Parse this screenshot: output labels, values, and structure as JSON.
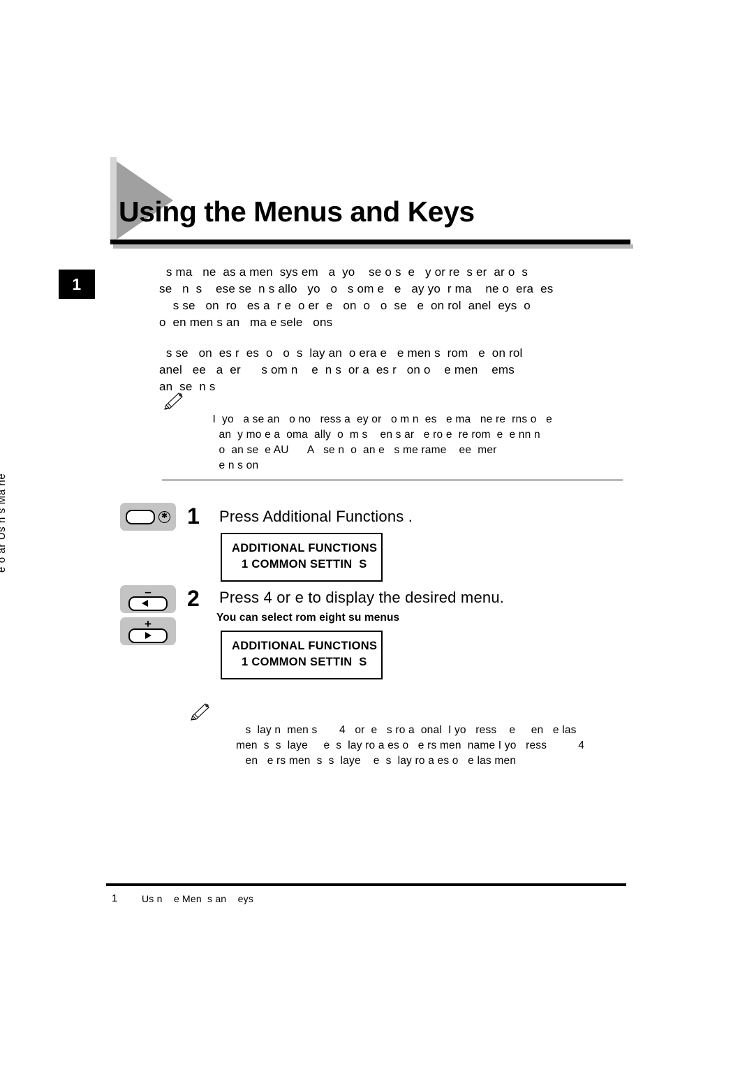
{
  "sidebar": {
    "chapter_number": "1",
    "vertical_label": "e o     ar Us n    s Ma    ne"
  },
  "header": {
    "title": "Using the Menus and Keys"
  },
  "body": {
    "paragraph_1": "  s ma   ne  as a men  sys em   a  yo    se o s  e   y or re  s er  ar o  s\nse   n  s    ese se  n s allo   yo   o   s om e   e   ay yo  r ma    ne o  era  es\n    s se   on  ro   es a  r e  o er  e   on  o   o  se   e  on rol  anel  eys  o\no  en men s an   ma e sele   ons",
    "paragraph_2": "  s se   on  es r  es  o   o  s  lay an  o era e   e men s  rom   e  on rol\nanel   ee   a  er      s om n    e  n s  or a  es r   on o    e men    ems\nan  se  n s"
  },
  "note_1": {
    "icon": "pencil-icon",
    "text": " I  yo   a se an   o no   ress a  ey or   o m n  es   e ma   ne re  rns o   e\n   an  y mo e a  oma  ally  o  m s    en s ar   e ro e  re rom  e  e nn n\n   o  an se  e AU      A   se n  o  an e   s me rame    ee  mer\n   e n s on"
  },
  "note_2": {
    "icon": "pencil-icon",
    "text": "   s  lay n  men s       4   or  e   s ro a  onal  I yo   ress    e     en   e las\nmen  s  s  laye     e  s  lay ro a es o   e rs men  name I yo   ress          4\n   en   e rs men  s  s  laye    e  s  lay ro a es o   e las men"
  },
  "steps": [
    {
      "number": "1",
      "instruction": "Press  Additional Functions .",
      "sub": "",
      "key_icon": "additional-functions-key",
      "lcd": {
        "line1": "ADDITIONAL FUNCTIONS",
        "line2": "1 COMMON SETTIN  S"
      }
    },
    {
      "number": "2",
      "instruction": "Press  4   or  e   to display the desired menu.",
      "sub": "You can select  rom eight su  menus",
      "key_icon_minus": "minus-left-arrow-key",
      "key_icon_plus": "plus-right-arrow-key",
      "key_minus_sign": "–",
      "key_plus_sign": "+",
      "lcd": {
        "line1": "ADDITIONAL FUNCTIONS",
        "line2": "1 COMMON SETTIN  S"
      }
    }
  ],
  "footer": {
    "page_number": "1",
    "text": "Us n    e Men  s an    eys"
  },
  "colors": {
    "triangle_light": "#c9c9c9",
    "triangle_dark": "#a0a0a0",
    "key_gray": "#c4c4c4",
    "rule_black": "#000000"
  }
}
